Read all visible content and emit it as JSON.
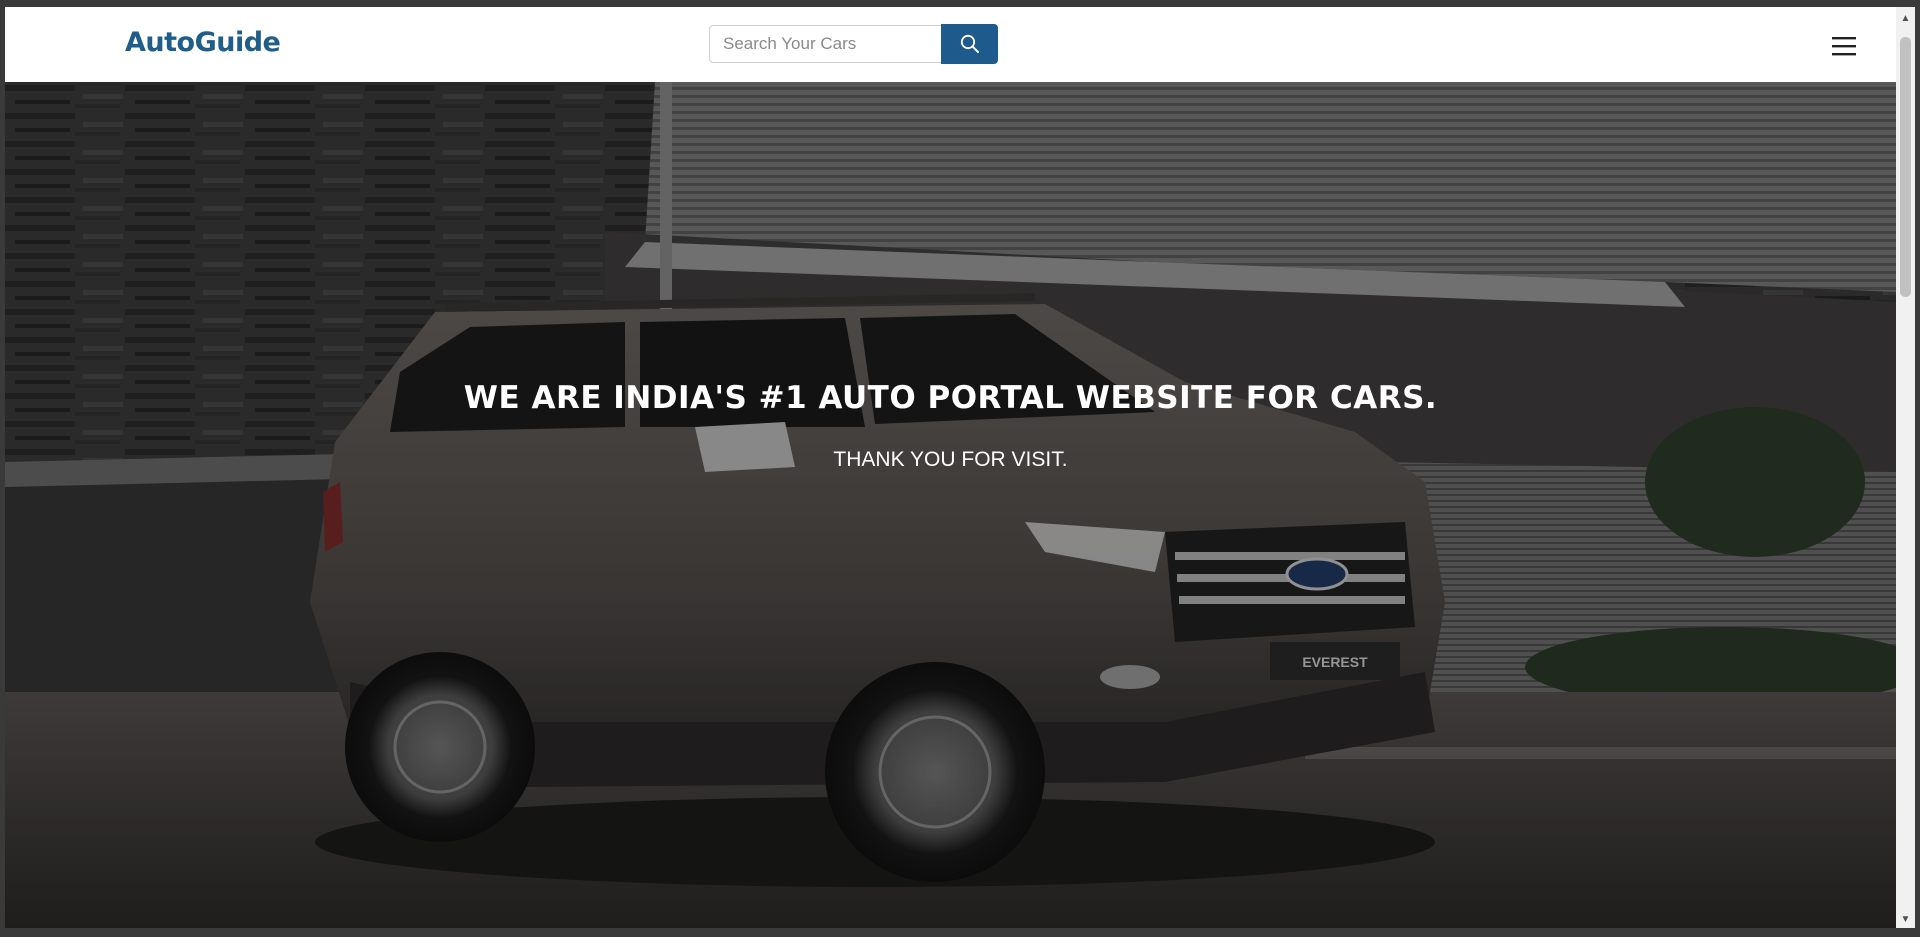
{
  "navbar": {
    "brand": "AutoGuide",
    "search_placeholder": "Search Your Cars",
    "search_icon": "search-icon",
    "menu_icon": "hamburger-menu-icon",
    "accent_color": "#1e5b8c"
  },
  "hero": {
    "title": "WE ARE INDIA'S #1 AUTO PORTAL WEBSITE FOR CARS.",
    "subtitle": "THANK YOU FOR VISIT.",
    "image_plate": "EVEREST"
  },
  "scrollbar": {
    "up_icon": "scroll-up-arrow-icon",
    "down_icon": "scroll-down-arrow-icon"
  }
}
